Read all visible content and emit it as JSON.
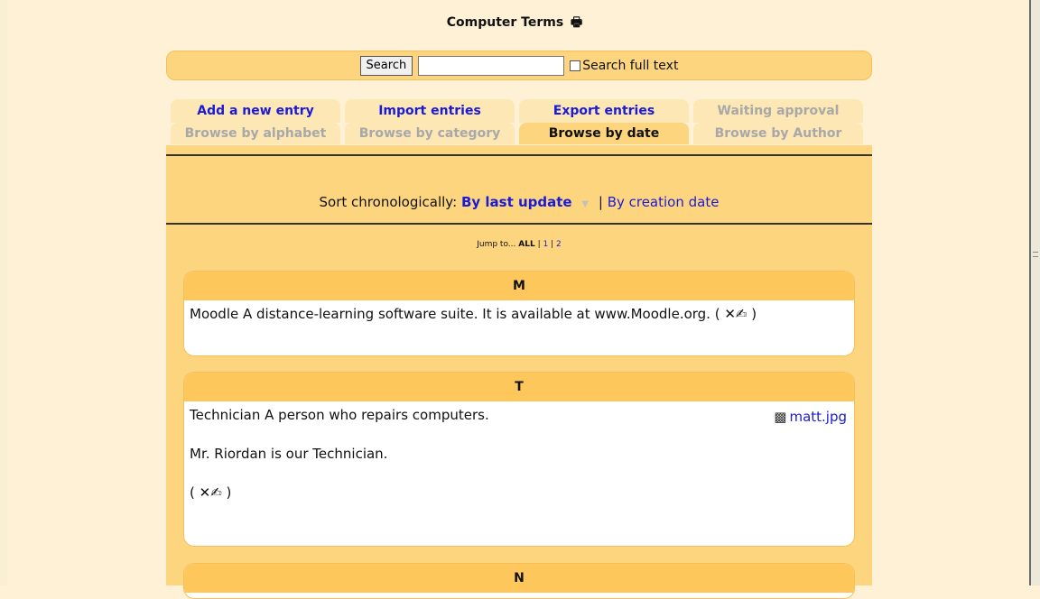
{
  "page": {
    "title": "Computer Terms",
    "printer_icon": "🖶"
  },
  "search": {
    "button": "Search",
    "value": "",
    "fulltext_label": "Search full text"
  },
  "tabs": {
    "row1": [
      "Add a new entry",
      "Import entries",
      "Export entries",
      "Waiting approval"
    ],
    "row2": [
      "Browse by alphabet",
      "Browse by category",
      "Browse by date",
      "Browse by Author"
    ]
  },
  "sort": {
    "label": "Sort chronologically:",
    "current": "By last update",
    "separator": "|",
    "alternate": "By creation date"
  },
  "jump": {
    "label": "Jump to...",
    "all": "ALL",
    "sep": "|",
    "pages": [
      "1",
      "2"
    ]
  },
  "entries": [
    {
      "letter": "M",
      "text": "Moodle A distance-learning software suite. It is available at www.Moodle.org.",
      "tools": "( ✕✍ )"
    },
    {
      "letter": "T",
      "text": "Technician A person who repairs computers.",
      "text2": "Mr. Riordan is our Technician.",
      "tools": "( ✕✍ )",
      "attachment": "matt.jpg"
    },
    {
      "letter": "N"
    }
  ],
  "colors": {
    "background": "#fef1d6",
    "panel": "#fdd57e",
    "link": "#1b1bd6"
  }
}
